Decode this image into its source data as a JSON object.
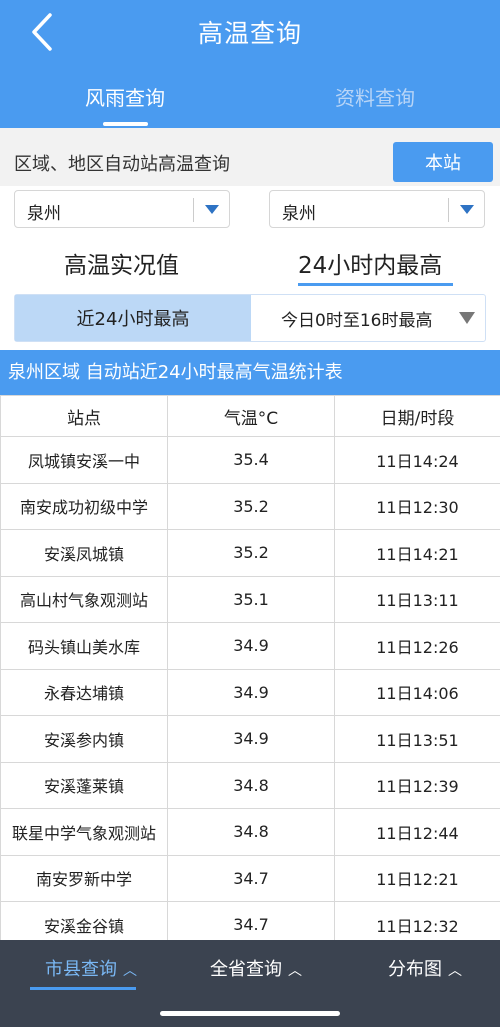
{
  "header": {
    "title": "高温查询",
    "tabs": [
      "风雨查询",
      "资料查询"
    ]
  },
  "search": {
    "label": "区域、地区自动站高温查询",
    "button": "本站"
  },
  "selects": [
    {
      "value": "泉州"
    },
    {
      "value": "泉州"
    }
  ],
  "modes": [
    "高温实况值",
    "24小时内最高"
  ],
  "segment": {
    "left": "近24小时最高",
    "right": "今日0时至16时最高"
  },
  "table": {
    "title": "泉州区域 自动站近24小时最高气温统计表",
    "headers": [
      "站点",
      "气温°C",
      "日期/时段"
    ],
    "rows": [
      [
        "凤城镇安溪一中",
        "35.4",
        "11日14:24"
      ],
      [
        "南安成功初级中学",
        "35.2",
        "11日12:30"
      ],
      [
        "安溪凤城镇",
        "35.2",
        "11日14:21"
      ],
      [
        "高山村气象观测站",
        "35.1",
        "11日13:11"
      ],
      [
        "码头镇山美水库",
        "34.9",
        "11日12:26"
      ],
      [
        "永春达埔镇",
        "34.9",
        "11日14:06"
      ],
      [
        "安溪参内镇",
        "34.9",
        "11日13:51"
      ],
      [
        "安溪蓬莱镇",
        "34.8",
        "11日12:39"
      ],
      [
        "联星中学气象观测站",
        "34.8",
        "11日12:44"
      ],
      [
        "南安罗新中学",
        "34.7",
        "11日12:21"
      ],
      [
        "安溪金谷镇",
        "34.7",
        "11日12:32"
      ]
    ]
  },
  "bottom_nav": [
    "市县查询",
    "全省查询",
    "分布图"
  ],
  "colors": {
    "primary": "#4a9bf0",
    "nav_bg": "#3b4350",
    "active_nav": "#7ab8f5"
  }
}
